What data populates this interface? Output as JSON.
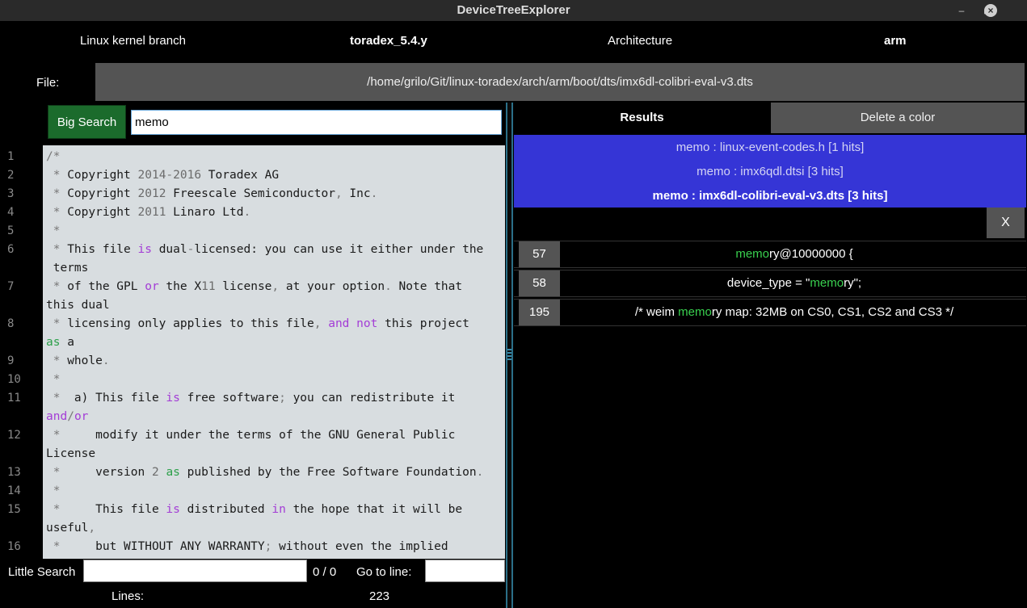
{
  "window": {
    "title": "DeviceTreeExplorer"
  },
  "header": {
    "branch_label": "Linux kernel branch",
    "branch_value": "toradex_5.4.y",
    "arch_label": "Architecture",
    "arch_value": "arm",
    "file_label": "File:",
    "file_path": "/home/grilo/Git/linux-toradex/arch/arm/boot/dts/imx6dl-colibri-eval-v3.dts"
  },
  "search": {
    "button_label": "Big Search",
    "value": "memo"
  },
  "editor": {
    "line_numbers": [
      "1",
      "2",
      "3",
      "4",
      "5",
      "6",
      "7",
      "8",
      "9",
      "10",
      "11",
      "12",
      "13",
      "14",
      "15",
      "16"
    ],
    "lines": [
      "/*",
      " * Copyright 2014-2016 Toradex AG",
      " * Copyright 2012 Freescale Semiconductor, Inc.",
      " * Copyright 2011 Linaro Ltd.",
      " *",
      " * This file is dual-licensed: you can use it either under the",
      " terms",
      " * of the GPL or the X11 license, at your option. Note that",
      "this dual",
      " * licensing only applies to this file, and not this project",
      "as a",
      " * whole.",
      " *",
      " *  a) This file is free software; you can redistribute it",
      "and/or",
      " *     modify it under the terms of the GNU General Public",
      "License",
      " *     version 2 as published by the Free Software Foundation.",
      " *",
      " *     This file is distributed in the hope that it will be",
      "useful,",
      " *     but WITHOUT ANY WARRANTY; without even the implied"
    ]
  },
  "bottom": {
    "little_search_label": "Little Search",
    "match_count": "0 / 0",
    "goto_label": "Go to line:",
    "lines_label": "Lines:",
    "lines_value": "223"
  },
  "results": {
    "tab_label": "Results",
    "delete_color_label": "Delete a color",
    "files": [
      "memo : linux-event-codes.h [1 hits]",
      "memo : imx6qdl.dtsi [3 hits]",
      "memo : imx6dl-colibri-eval-v3.dts [3 hits]"
    ],
    "close_label": "X",
    "hits": [
      {
        "line": "57",
        "pre": "",
        "match": "memo",
        "post": "ry@10000000 {"
      },
      {
        "line": "58",
        "pre": "device_type = \"",
        "match": "memo",
        "post": "ry\";"
      },
      {
        "line": "195",
        "pre": "/* weim ",
        "match": "memo",
        "post": "ry map: 32MB on CS0, CS1, CS2 and CS3 */"
      }
    ]
  },
  "colors": {
    "accent": "#3535d6",
    "search_button": "#1b6b2c",
    "highlight": "#39d14f",
    "panel": "#545454"
  }
}
